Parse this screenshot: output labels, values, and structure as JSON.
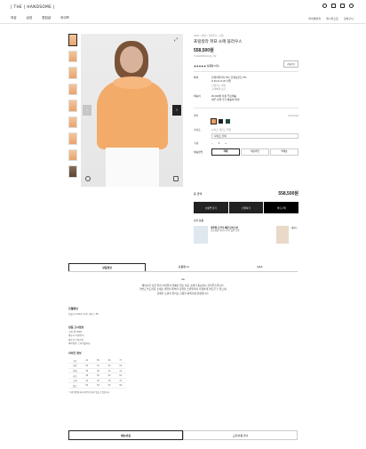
{
  "header": {
    "logo": "| THE | HANDSOME |",
    "nav": [
      "여성",
      "남성",
      "편집샵",
      "라이프"
    ],
    "util": [
      "마이페이지",
      "위시리스트",
      "장바구니"
    ]
  },
  "gallery": {
    "thumb_count": 10,
    "arrow_prev": "‹",
    "arrow_next": "›",
    "expand": "⤢"
  },
  "product": {
    "breadcrumb": "SJSJ > 여성 > 블라우스 > 셔츠",
    "name": "프릴칼라 퍼프 소매 블라우스",
    "price": "558,500원",
    "code": "TS2E2WBL011W_OR",
    "rating": "★★★★★ 상품평 0개+",
    "review_btn": "리뷰보기",
    "share_icon": "share-icon",
    "wish_icon": "heart-icon"
  },
  "benefits": {
    "label1": "혜택",
    "v1": "한섬마일리지 5%, 한섬포인트 5%",
    "v1b": "H.Point 0.1% 적립",
    "v1c": "신용카드 제휴",
    "v1d": "구매혜택 보기",
    "label2": "배송비",
    "v2": "30,000원 이상 무료배송",
    "v2b": "제주 지역 추가 배송비 발생"
  },
  "options": {
    "color_label": "컬러",
    "color_value": "ORANGE",
    "colors": [
      "#f29c5c",
      "#222222",
      "#1f4a3a"
    ],
    "size_label": "사이즈",
    "size_sub": "사이즈 재입고 알림",
    "size_select": "사이즈 선택",
    "qty_label": "수량",
    "qty_value": "1",
    "delivery_label": "배송방법",
    "delivery_opts": [
      "택배",
      "매장픽업",
      "퀵배송"
    ]
  },
  "total": {
    "label": "총 금액",
    "value": "558,500원"
  },
  "buttons": {
    "cart": "쇼핑백 담기",
    "gift": "선물하기",
    "buy": "바로구매"
  },
  "promo": {
    "title": "관련 상품",
    "item1": "내추럴 오가닉 세럼 모이스처",
    "item1_desc": "신규회원 가입시 추가 할인 쿠폰",
    "item2": "에센스"
  },
  "tabs": [
    "상품정보",
    "상품평 0+",
    "Q&A"
  ],
  "description": {
    "dot": "●●",
    "lines": [
      "페미닌한 프릴 칼라 디테일과 볼륨감 있는 퍼프 소매가 돋보이는 블라우스입니다.",
      "가볍고 부드러운 소재로 데일리 룩부터 포멀한 스타일까지 다양하게 연출할 수 있으며,",
      "경쾌한 오렌지 컬러로 산뜻한 분위기를 완성합니다."
    ]
  },
  "detail": {
    "model_title": "모델정보",
    "model_info": "모델 키 170cm, 착용 사이즈: 55",
    "care_title": "상품 고시정보",
    "care_lines": [
      "소재: 면 100%",
      "제조국: 대한민국",
      "제조사: (주)한섬",
      "세탁방법: 드라이클리닝"
    ],
    "size_title": "사이즈 정보",
    "size_header": [
      "구분",
      "44",
      "55",
      "66",
      "77"
    ],
    "size_rows": [
      [
        "총장",
        "60",
        "61",
        "62",
        "63"
      ],
      [
        "어깨",
        "38",
        "39",
        "40",
        "41"
      ],
      [
        "가슴",
        "48",
        "50",
        "52",
        "54"
      ],
      [
        "소매",
        "44",
        "45",
        "46",
        "47"
      ],
      [
        "밑단",
        "50",
        "52",
        "54",
        "56"
      ]
    ],
    "size_note": "* 측정 방법에 따라 약간의 오차가 있을 수 있습니다."
  },
  "bottom_tabs": [
    "배송/반품",
    "교환/반품 안내"
  ]
}
